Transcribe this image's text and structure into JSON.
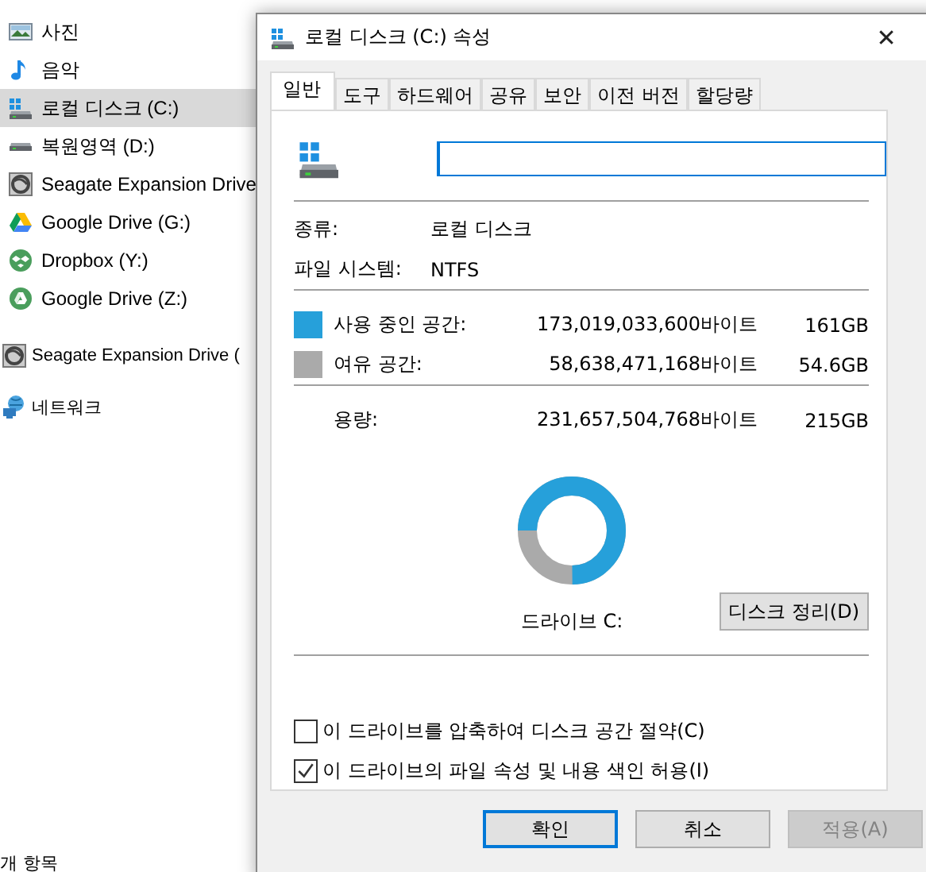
{
  "sidebar": {
    "pc_items": [
      {
        "label": "사진",
        "kind": "photo",
        "selected": false
      },
      {
        "label": "음악",
        "kind": "music",
        "selected": false
      },
      {
        "label": "로컬 디스크 (C:)",
        "kind": "windrive",
        "selected": true
      },
      {
        "label": "복원영역 (D:)",
        "kind": "drive",
        "selected": false
      },
      {
        "label": "Seagate Expansion Drive",
        "kind": "seagate",
        "selected": false
      },
      {
        "label": "Google Drive (G:)",
        "kind": "gdrive",
        "selected": false
      },
      {
        "label": "Dropbox (Y:)",
        "kind": "dropbox",
        "selected": false
      },
      {
        "label": "Google Drive (Z:)",
        "kind": "gdrive2",
        "selected": false
      }
    ],
    "top_items": [
      {
        "label": "Seagate Expansion Drive (",
        "kind": "seagate",
        "selected": false
      },
      {
        "label": "네트워크",
        "kind": "network",
        "selected": false
      }
    ]
  },
  "status_bar": {
    "item_count": "개 항목"
  },
  "dialog": {
    "title": "로컬 디스크 (C:) 속성",
    "close": "✕",
    "tabs": [
      {
        "label": "일반",
        "selected": true
      },
      {
        "label": "도구",
        "selected": false
      },
      {
        "label": "하드웨어",
        "selected": false
      },
      {
        "label": "공유",
        "selected": false
      },
      {
        "label": "보안",
        "selected": false
      },
      {
        "label": "이전 버전",
        "selected": false
      },
      {
        "label": "할당량",
        "selected": false
      }
    ],
    "name_field": {
      "focused": true
    },
    "type": {
      "label": "종류:",
      "value": "로컬 디스크"
    },
    "file_system": {
      "label": "파일 시스템:",
      "value": "NTFS"
    },
    "space": [
      {
        "label": "사용 중인 공간:",
        "bytes": "173,019,033,600바이트",
        "size": "161GB",
        "color": "#26a0da"
      },
      {
        "label": "여유 공간:",
        "bytes": "58,638,471,168바이트",
        "size": "54.6GB",
        "color": "#aaaaaa"
      }
    ],
    "capacity": {
      "label": "용량:",
      "bytes": "231,657,504,768바이트",
      "size": "215GB"
    },
    "usage": {
      "level": 0.747
    },
    "drive_label": "드라이브 C:",
    "cleanup_button": "디스크 정리(D)",
    "options": [
      {
        "label": "이 드라이브를 압축하여 디스크 공간 절약(C)",
        "checked": false
      },
      {
        "label": "이 드라이브의 파일 속성 및 내용 색인 허용(I)",
        "checked": true
      }
    ],
    "buttons": [
      {
        "label": "확인",
        "kind": "default",
        "disabled": false
      },
      {
        "label": "취소",
        "kind": "normal",
        "disabled": false
      },
      {
        "label": "적용(A)",
        "kind": "normal",
        "disabled": true
      }
    ]
  }
}
